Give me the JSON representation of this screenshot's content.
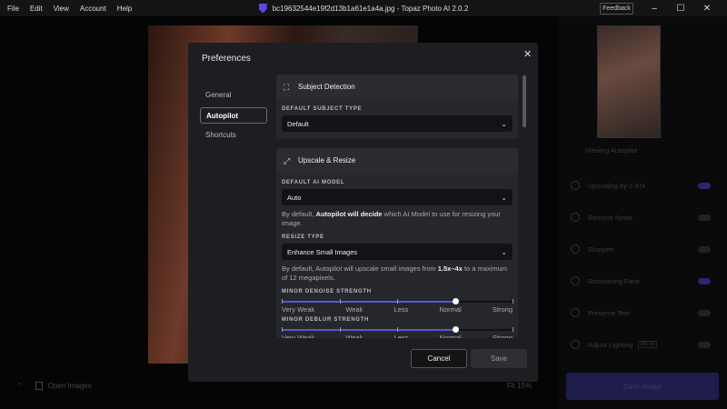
{
  "menu": [
    "File",
    "Edit",
    "View",
    "Account",
    "Help"
  ],
  "window_title": "bc19632544e19f2d13b1a61e1a4a.jpg - Topaz Photo AI 2.0.2",
  "feedback": "Feedback",
  "right_panel": {
    "viewing": "Viewing Autopilot",
    "rows": [
      {
        "label": "Upscaling by 2.87x",
        "on": true
      },
      {
        "label": "Remove Noise",
        "on": false
      },
      {
        "label": "Sharpen",
        "on": false
      },
      {
        "label": "Recovering Face",
        "on": true
      },
      {
        "label": "Preserve Text",
        "on": false
      },
      {
        "label": "Adjust Lighting",
        "badge": "BETA",
        "on": false
      }
    ],
    "save_image": "Save Image"
  },
  "bottom": {
    "open_images": "Open Images",
    "zoom": "Fit 15%"
  },
  "modal": {
    "title": "Preferences",
    "nav": [
      "General",
      "Autopilot",
      "Shortcuts"
    ],
    "active_nav": "Autopilot",
    "subject": {
      "title": "Subject Detection",
      "label": "DEFAULT SUBJECT TYPE",
      "value": "Default"
    },
    "upscale": {
      "title": "Upscale & Resize",
      "model_label": "DEFAULT AI MODEL",
      "model_value": "Auto",
      "help1_pre": "By default, ",
      "help1_bold": "Autopilot will decide",
      "help1_post": " which AI Model to use for resizing your image.",
      "resize_label": "RESIZE TYPE",
      "resize_value": "Enhance Small Images",
      "help2_pre": "By default, Autopilot will upscale small images from ",
      "help2_bold": "1.5x–4x",
      "help2_post": " to a maximum of 12 megapixels.",
      "denoise_label": "MINOR DENOISE STRENGTH",
      "deblur_label": "MINOR DEBLUR STRENGTH",
      "levels": [
        "Very Weak",
        "Weak",
        "Less",
        "Normal",
        "Strong"
      ],
      "denoise_value": "Normal",
      "deblur_value": "Normal"
    },
    "cancel": "Cancel",
    "save": "Save"
  },
  "colors": {
    "accent": "#5458d8"
  }
}
